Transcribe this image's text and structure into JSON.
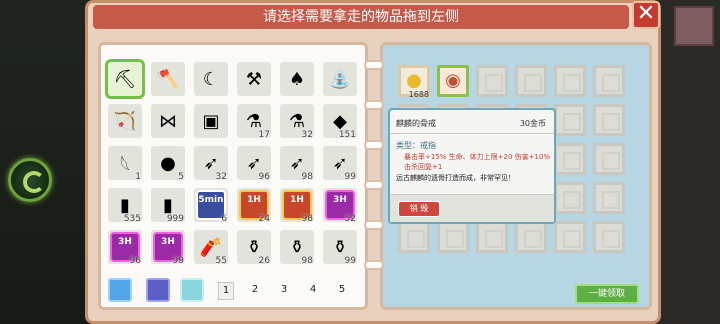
{
  "title": "请选择需要拿走的物品拖到左侧",
  "close_label": "✕",
  "left_items": [
    {
      "icon": "pickaxe-icon",
      "glyph": "⛏",
      "qty": "",
      "selected": true
    },
    {
      "icon": "axe-icon",
      "glyph": "🪓",
      "qty": ""
    },
    {
      "icon": "sickle-icon",
      "glyph": "☾",
      "qty": ""
    },
    {
      "icon": "hoe-icon",
      "glyph": "⚒",
      "qty": ""
    },
    {
      "icon": "shovel-icon",
      "glyph": "♠",
      "qty": ""
    },
    {
      "icon": "watering-can-icon",
      "glyph": "⛲",
      "qty": ""
    },
    {
      "icon": "bow-icon",
      "glyph": "🏹",
      "qty": ""
    },
    {
      "icon": "bowtie-icon",
      "glyph": "⋈",
      "qty": ""
    },
    {
      "icon": "barrel-icon",
      "glyph": "▣",
      "qty": ""
    },
    {
      "icon": "orange-potion-icon",
      "glyph": "⚗",
      "qty": "17"
    },
    {
      "icon": "purple-potion-icon",
      "glyph": "⚗",
      "qty": "32"
    },
    {
      "icon": "crystal-icon",
      "glyph": "◆",
      "qty": "151"
    },
    {
      "icon": "wing-icon",
      "glyph": "𓆩",
      "qty": "1"
    },
    {
      "icon": "red-blob-icon",
      "glyph": "●",
      "qty": "5"
    },
    {
      "icon": "rocket-icon",
      "glyph": "➶",
      "qty": "32"
    },
    {
      "icon": "rocket-icon",
      "glyph": "➶",
      "qty": "96"
    },
    {
      "icon": "rocket-icon",
      "glyph": "➶",
      "qty": "98"
    },
    {
      "icon": "rocket-icon",
      "glyph": "➶",
      "qty": "99"
    },
    {
      "icon": "blue-vial-icon",
      "glyph": "▮",
      "qty": "535"
    },
    {
      "icon": "blue-vial-icon",
      "glyph": "▮",
      "qty": "999"
    },
    {
      "icon": "buff-5min-icon",
      "buff": "blue",
      "buff_text": "5min",
      "qty": "6"
    },
    {
      "icon": "buff-1h-icon",
      "buff": "red",
      "buff_text": "1H",
      "qty": "24"
    },
    {
      "icon": "buff-1h-icon",
      "buff": "red",
      "buff_text": "1H",
      "qty": "98"
    },
    {
      "icon": "buff-3h-icon",
      "buff": "purple",
      "buff_text": "3H",
      "qty": "52"
    },
    {
      "icon": "buff-3h-icon",
      "buff": "purple",
      "buff_text": "3H",
      "qty": "96"
    },
    {
      "icon": "buff-3h-icon",
      "buff": "purple",
      "buff_text": "3H",
      "qty": "99"
    },
    {
      "icon": "firecracker-icon",
      "glyph": "🧨",
      "qty": "55"
    },
    {
      "icon": "pot-icon",
      "glyph": "⚱",
      "qty": "26"
    },
    {
      "icon": "pot-icon",
      "glyph": "⚱",
      "qty": "98"
    },
    {
      "icon": "pot-icon",
      "glyph": "⚱",
      "qty": "99"
    }
  ],
  "right_items": [
    {
      "icon": "coin-icon",
      "glyph": "●",
      "qty": "1688"
    },
    {
      "icon": "ring-icon",
      "glyph": "◉",
      "qty": ""
    }
  ],
  "tooltip": {
    "name": "麒麟的骨戒",
    "price": "30金币",
    "type": "类型：戒指",
    "stat1": "暴击率+15%   生命、体力上限+20  伤害+10%",
    "stat2": "击杀回复+1",
    "desc": "远古麒麟的遗骨打造而成，非常罕见！",
    "destroy": "销 毁"
  },
  "pages": [
    "1",
    "2",
    "3",
    "4",
    "5"
  ],
  "active_page": "1",
  "collect_label": "一键领取",
  "colors": {
    "accent_green": "#5fb044",
    "title_red": "#c65a48"
  }
}
